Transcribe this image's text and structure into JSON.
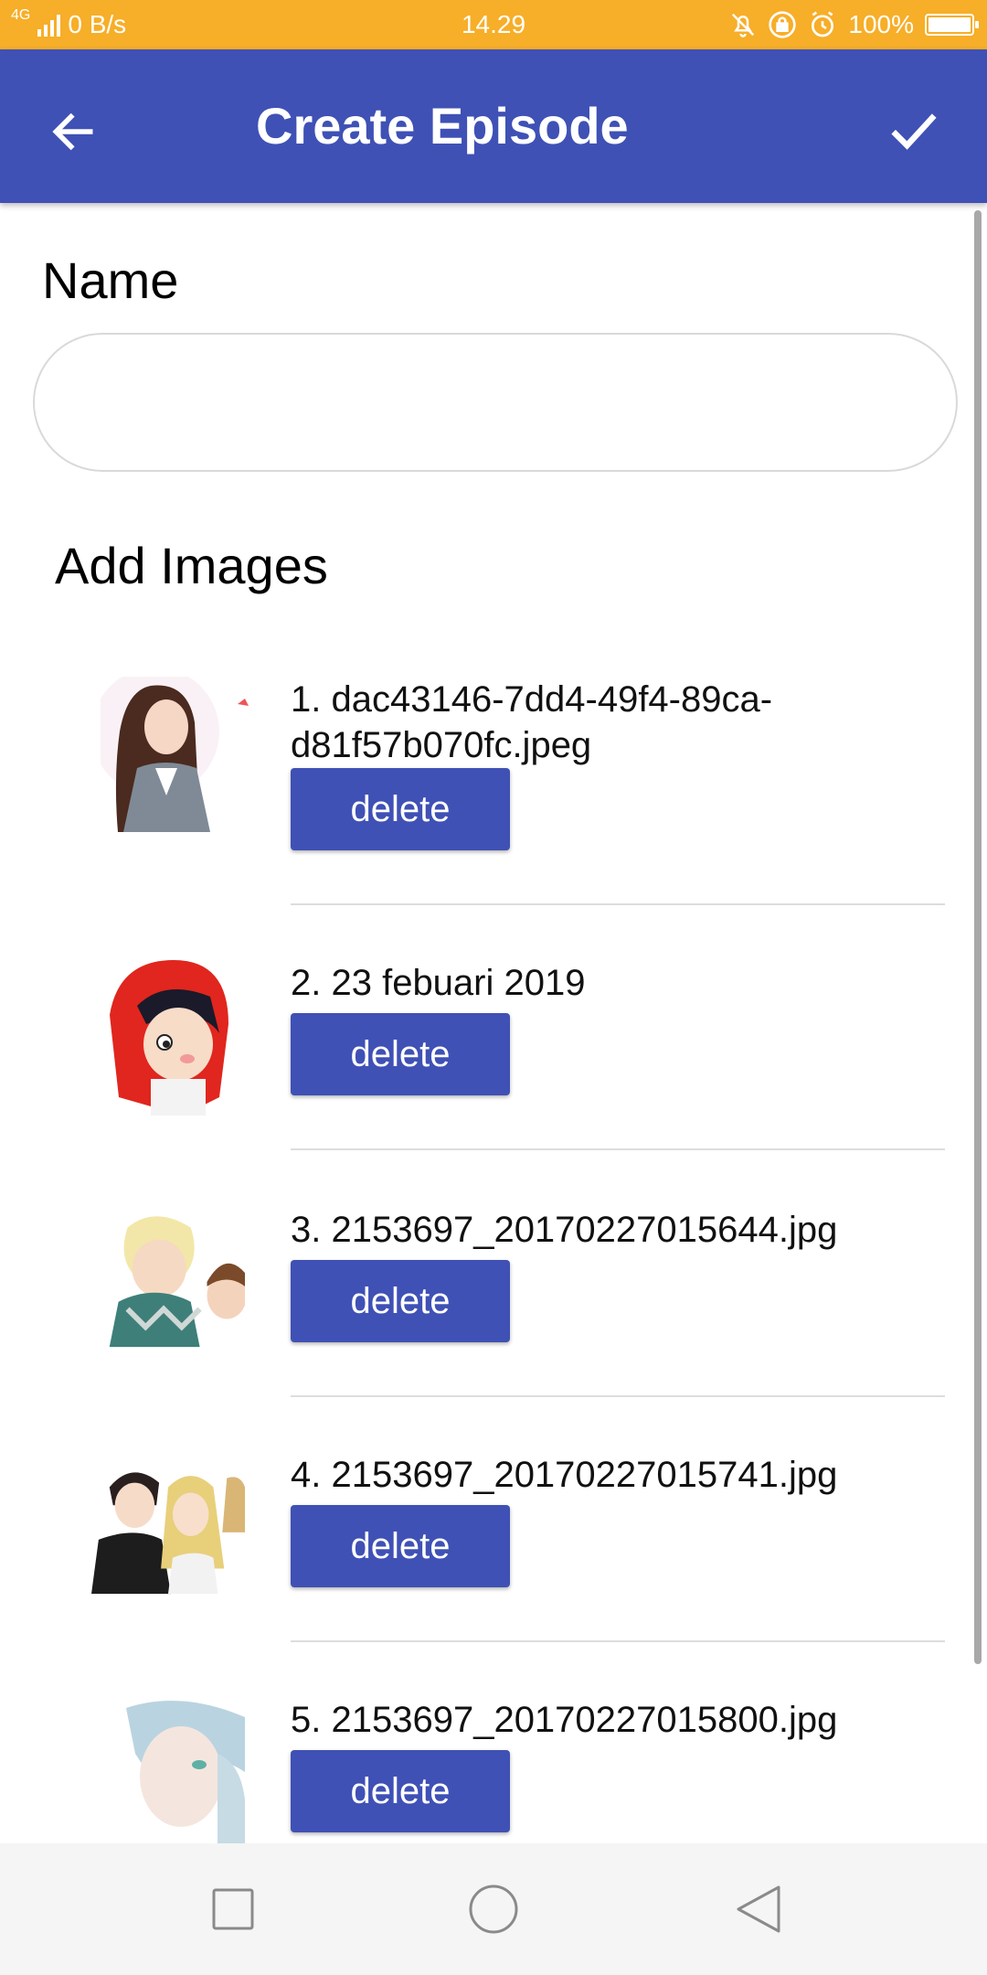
{
  "status_bar": {
    "network_type": "4G",
    "speed": "0 B/s",
    "time": "14.29",
    "battery": "100%",
    "battery_level": 1.0
  },
  "app_bar": {
    "title": "Create Episode",
    "back_icon": "arrow-left-icon",
    "confirm_icon": "check-icon"
  },
  "form": {
    "name_label": "Name",
    "name_value": "",
    "add_images_label": "Add Images"
  },
  "images": [
    {
      "filename": "1. dac43146-7dd4-49f4-89ca-d81f57b070fc.jpeg",
      "delete_label": "delete"
    },
    {
      "filename": "2. 23 febuari 2019",
      "delete_label": "delete"
    },
    {
      "filename": "3. 2153697_20170227015644.jpg",
      "delete_label": "delete"
    },
    {
      "filename": "4. 2153697_20170227015741.jpg",
      "delete_label": "delete"
    },
    {
      "filename": "5. 2153697_20170227015800.jpg",
      "delete_label": "delete"
    }
  ],
  "nav_bar": {
    "recents_icon": "square-icon",
    "home_icon": "circle-icon",
    "back_icon": "triangle-back-icon"
  },
  "colors": {
    "status_bar": "#F7AE28",
    "primary": "#3F51B5",
    "nav_bar": "#F5F5F5"
  }
}
